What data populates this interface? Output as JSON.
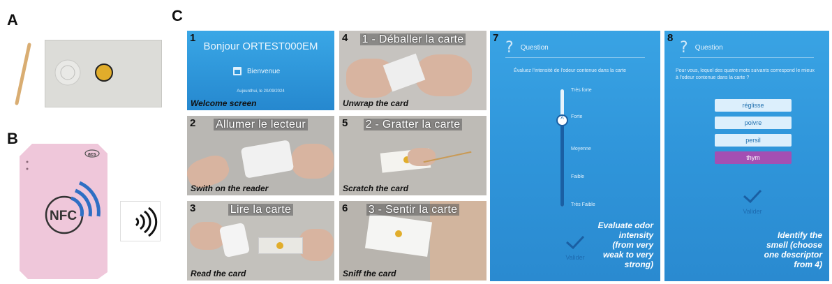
{
  "letters": {
    "a": "A",
    "b": "B",
    "c": "C"
  },
  "panel_b": {
    "nfc_text": "NFC",
    "brand": "acs"
  },
  "tiles": [
    {
      "num": "1",
      "caption": "Welcome screen",
      "greeting": "Bonjour ORTEST000EM",
      "welcome": "Bienvenue",
      "date": "Aujourdhui, le 20/09/2024"
    },
    {
      "num": "2",
      "caption": "Swith on  the reader",
      "french": "Allumer le lecteur"
    },
    {
      "num": "3",
      "caption": "Read the card",
      "french": "Lire la carte"
    },
    {
      "num": "4",
      "caption": "Unwrap the card",
      "french": "1 - Déballer la carte"
    },
    {
      "num": "5",
      "caption": "Scratch the card",
      "french": "2 - Gratter la carte"
    },
    {
      "num": "6",
      "caption": "Sniff the card",
      "french": "3 - Sentir la carte"
    }
  ],
  "panel7": {
    "num": "7",
    "header": "Question",
    "prompt": "Évaluez l'intensité de l'odeur contenue dans la carte",
    "levels": [
      "Très forte",
      "Forte",
      "Moyenne",
      "Faible",
      "Très Faible"
    ],
    "selected_level": "Forte",
    "validate": "Valider",
    "caption": [
      "Evaluate odor",
      "intensity",
      "(from very",
      "weak to very",
      "strong)"
    ]
  },
  "panel8": {
    "num": "8",
    "header": "Question",
    "prompt": [
      "Pour vous, lequel des quatre mots suivants correspond le mieux",
      "à l'odeur contenue dans la carte ?"
    ],
    "choices": [
      "réglisse",
      "poivre",
      "persil",
      "thym"
    ],
    "selected_choice": "thym",
    "validate": "Valider",
    "caption": [
      "Identify the",
      "smell (choose",
      "one descriptor",
      "from 4)"
    ]
  },
  "colors": {
    "app_blue": "#2f95da",
    "selected_purple": "#a34fb3",
    "nfc_blue": "#2e6fc4"
  }
}
